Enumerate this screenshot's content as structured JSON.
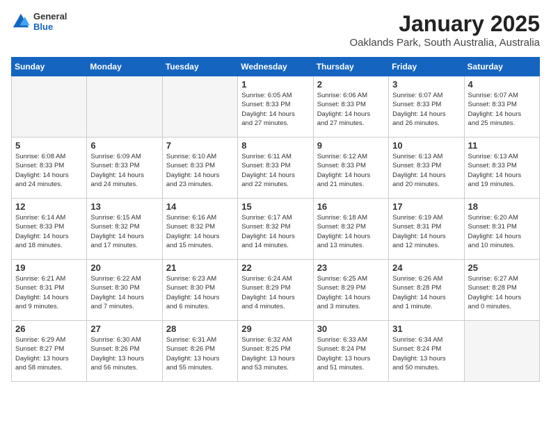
{
  "header": {
    "logo_general": "General",
    "logo_blue": "Blue",
    "month": "January 2025",
    "location": "Oaklands Park, South Australia, Australia"
  },
  "weekdays": [
    "Sunday",
    "Monday",
    "Tuesday",
    "Wednesday",
    "Thursday",
    "Friday",
    "Saturday"
  ],
  "weeks": [
    [
      {
        "day": "",
        "info": ""
      },
      {
        "day": "",
        "info": ""
      },
      {
        "day": "",
        "info": ""
      },
      {
        "day": "1",
        "info": "Sunrise: 6:05 AM\nSunset: 8:33 PM\nDaylight: 14 hours\nand 27 minutes."
      },
      {
        "day": "2",
        "info": "Sunrise: 6:06 AM\nSunset: 8:33 PM\nDaylight: 14 hours\nand 27 minutes."
      },
      {
        "day": "3",
        "info": "Sunrise: 6:07 AM\nSunset: 8:33 PM\nDaylight: 14 hours\nand 26 minutes."
      },
      {
        "day": "4",
        "info": "Sunrise: 6:07 AM\nSunset: 8:33 PM\nDaylight: 14 hours\nand 25 minutes."
      }
    ],
    [
      {
        "day": "5",
        "info": "Sunrise: 6:08 AM\nSunset: 8:33 PM\nDaylight: 14 hours\nand 24 minutes."
      },
      {
        "day": "6",
        "info": "Sunrise: 6:09 AM\nSunset: 8:33 PM\nDaylight: 14 hours\nand 24 minutes."
      },
      {
        "day": "7",
        "info": "Sunrise: 6:10 AM\nSunset: 8:33 PM\nDaylight: 14 hours\nand 23 minutes."
      },
      {
        "day": "8",
        "info": "Sunrise: 6:11 AM\nSunset: 8:33 PM\nDaylight: 14 hours\nand 22 minutes."
      },
      {
        "day": "9",
        "info": "Sunrise: 6:12 AM\nSunset: 8:33 PM\nDaylight: 14 hours\nand 21 minutes."
      },
      {
        "day": "10",
        "info": "Sunrise: 6:13 AM\nSunset: 8:33 PM\nDaylight: 14 hours\nand 20 minutes."
      },
      {
        "day": "11",
        "info": "Sunrise: 6:13 AM\nSunset: 8:33 PM\nDaylight: 14 hours\nand 19 minutes."
      }
    ],
    [
      {
        "day": "12",
        "info": "Sunrise: 6:14 AM\nSunset: 8:33 PM\nDaylight: 14 hours\nand 18 minutes."
      },
      {
        "day": "13",
        "info": "Sunrise: 6:15 AM\nSunset: 8:32 PM\nDaylight: 14 hours\nand 17 minutes."
      },
      {
        "day": "14",
        "info": "Sunrise: 6:16 AM\nSunset: 8:32 PM\nDaylight: 14 hours\nand 15 minutes."
      },
      {
        "day": "15",
        "info": "Sunrise: 6:17 AM\nSunset: 8:32 PM\nDaylight: 14 hours\nand 14 minutes."
      },
      {
        "day": "16",
        "info": "Sunrise: 6:18 AM\nSunset: 8:32 PM\nDaylight: 14 hours\nand 13 minutes."
      },
      {
        "day": "17",
        "info": "Sunrise: 6:19 AM\nSunset: 8:31 PM\nDaylight: 14 hours\nand 12 minutes."
      },
      {
        "day": "18",
        "info": "Sunrise: 6:20 AM\nSunset: 8:31 PM\nDaylight: 14 hours\nand 10 minutes."
      }
    ],
    [
      {
        "day": "19",
        "info": "Sunrise: 6:21 AM\nSunset: 8:31 PM\nDaylight: 14 hours\nand 9 minutes."
      },
      {
        "day": "20",
        "info": "Sunrise: 6:22 AM\nSunset: 8:30 PM\nDaylight: 14 hours\nand 7 minutes."
      },
      {
        "day": "21",
        "info": "Sunrise: 6:23 AM\nSunset: 8:30 PM\nDaylight: 14 hours\nand 6 minutes."
      },
      {
        "day": "22",
        "info": "Sunrise: 6:24 AM\nSunset: 8:29 PM\nDaylight: 14 hours\nand 4 minutes."
      },
      {
        "day": "23",
        "info": "Sunrise: 6:25 AM\nSunset: 8:29 PM\nDaylight: 14 hours\nand 3 minutes."
      },
      {
        "day": "24",
        "info": "Sunrise: 6:26 AM\nSunset: 8:28 PM\nDaylight: 14 hours\nand 1 minute."
      },
      {
        "day": "25",
        "info": "Sunrise: 6:27 AM\nSunset: 8:28 PM\nDaylight: 14 hours\nand 0 minutes."
      }
    ],
    [
      {
        "day": "26",
        "info": "Sunrise: 6:29 AM\nSunset: 8:27 PM\nDaylight: 13 hours\nand 58 minutes."
      },
      {
        "day": "27",
        "info": "Sunrise: 6:30 AM\nSunset: 8:26 PM\nDaylight: 13 hours\nand 56 minutes."
      },
      {
        "day": "28",
        "info": "Sunrise: 6:31 AM\nSunset: 8:26 PM\nDaylight: 13 hours\nand 55 minutes."
      },
      {
        "day": "29",
        "info": "Sunrise: 6:32 AM\nSunset: 8:25 PM\nDaylight: 13 hours\nand 53 minutes."
      },
      {
        "day": "30",
        "info": "Sunrise: 6:33 AM\nSunset: 8:24 PM\nDaylight: 13 hours\nand 51 minutes."
      },
      {
        "day": "31",
        "info": "Sunrise: 6:34 AM\nSunset: 8:24 PM\nDaylight: 13 hours\nand 50 minutes."
      },
      {
        "day": "",
        "info": ""
      }
    ]
  ]
}
